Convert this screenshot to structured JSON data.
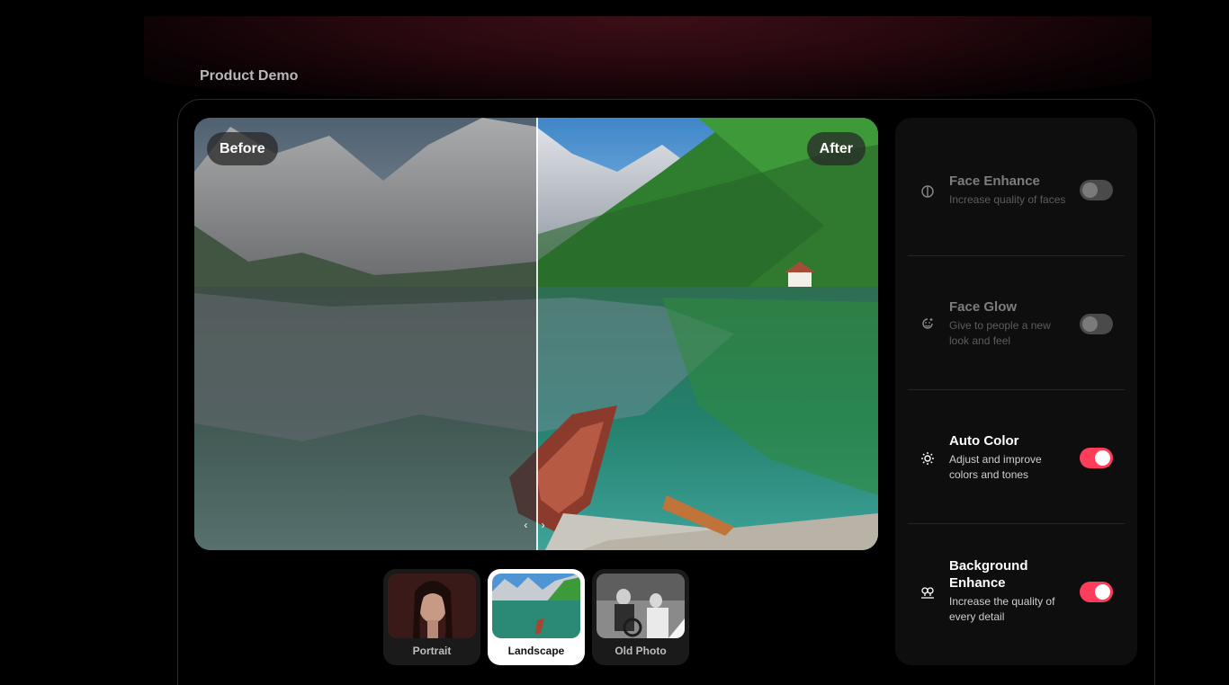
{
  "section": {
    "title": "Product Demo"
  },
  "compare": {
    "before_label": "Before",
    "after_label": "After",
    "handle_glyph": "‹ ›",
    "split_fraction": 0.5
  },
  "thumbnails": [
    {
      "label": "Portrait",
      "active": false
    },
    {
      "label": "Landscape",
      "active": true
    },
    {
      "label": "Old Photo",
      "active": false
    }
  ],
  "options": [
    {
      "icon": "face-enhance-icon",
      "title": "Face Enhance",
      "description": "Increase quality of faces",
      "enabled": false
    },
    {
      "icon": "face-glow-icon",
      "title": "Face Glow",
      "description": "Give to people a new look and feel",
      "enabled": false
    },
    {
      "icon": "sun-icon",
      "title": "Auto Color",
      "description": "Adjust and improve colors and tones",
      "enabled": true
    },
    {
      "icon": "background-enhance-icon",
      "title": "Background Enhance",
      "description": "Increase the quality of every detail",
      "enabled": true
    }
  ],
  "colors": {
    "accent": "#ff3d5a",
    "panel": "#0e0e0e",
    "toggle_off": "#4a4a4a"
  }
}
